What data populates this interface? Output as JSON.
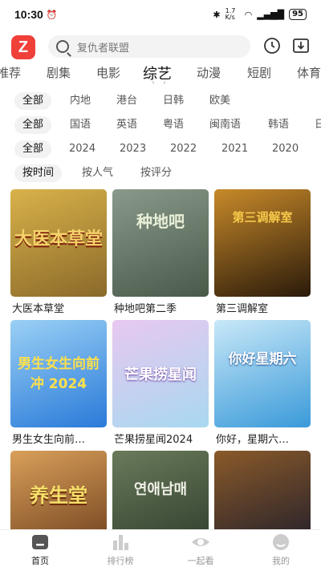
{
  "status_bar": {
    "time": "10:30",
    "battery": "95",
    "net": "1.7 K/s"
  },
  "search": {
    "placeholder": "复仇者联盟"
  },
  "category_tabs": [
    "推荐",
    "剧集",
    "电影",
    "综艺",
    "动漫",
    "短剧",
    "体育"
  ],
  "active_category": "综艺",
  "filters": {
    "region": [
      "全部",
      "内地",
      "港台",
      "日韩",
      "欧美"
    ],
    "language": [
      "全部",
      "国语",
      "英语",
      "粤语",
      "闽南语",
      "韩语",
      "日"
    ],
    "year": [
      "全部",
      "2024",
      "2023",
      "2022",
      "2021",
      "2020"
    ],
    "sort": [
      "按时间",
      "按人气",
      "按评分"
    ]
  },
  "shows": [
    {
      "title": "大医本草堂",
      "poster_text": "大医本草堂",
      "colors": [
        "#8a6a2a",
        "#d9b24a"
      ]
    },
    {
      "title": "种地吧第二季",
      "poster_text": "种地吧",
      "colors": [
        "#4a5a4a",
        "#8a9a8a"
      ]
    },
    {
      "title": "第三调解室",
      "poster_text": "第三调解室",
      "colors": [
        "#2a1a0a",
        "#c88a2a"
      ]
    },
    {
      "title": "男生女生向前…",
      "poster_text": "男生女生向前冲 2024",
      "colors": [
        "#2a7ad9",
        "#9ad0f5"
      ]
    },
    {
      "title": "芒果捞星闻2024",
      "poster_text": "芒果捞星闻",
      "colors": [
        "#a8d8f0",
        "#e8c8f0"
      ]
    },
    {
      "title": "你好，星期六…",
      "poster_text": "你好星期六",
      "colors": [
        "#3a9ad9",
        "#c8e8f8"
      ]
    },
    {
      "title": "",
      "poster_text": "养生堂",
      "colors": [
        "#6a3a1a",
        "#d9a05a"
      ]
    },
    {
      "title": "",
      "poster_text": "연애남매",
      "colors": [
        "#2a3a2a",
        "#6a7a5a"
      ]
    },
    {
      "title": "",
      "poster_text": "",
      "colors": [
        "#1a1a2a",
        "#8a5a2a"
      ]
    }
  ],
  "bottom_tabs": [
    {
      "label": "首页",
      "icon": "home-icon",
      "active": true
    },
    {
      "label": "排行榜",
      "icon": "ranking-icon",
      "active": false
    },
    {
      "label": "一起看",
      "icon": "eye-icon",
      "active": false
    },
    {
      "label": "我的",
      "icon": "profile-icon",
      "active": false
    }
  ],
  "accent_color": "#f0403a"
}
